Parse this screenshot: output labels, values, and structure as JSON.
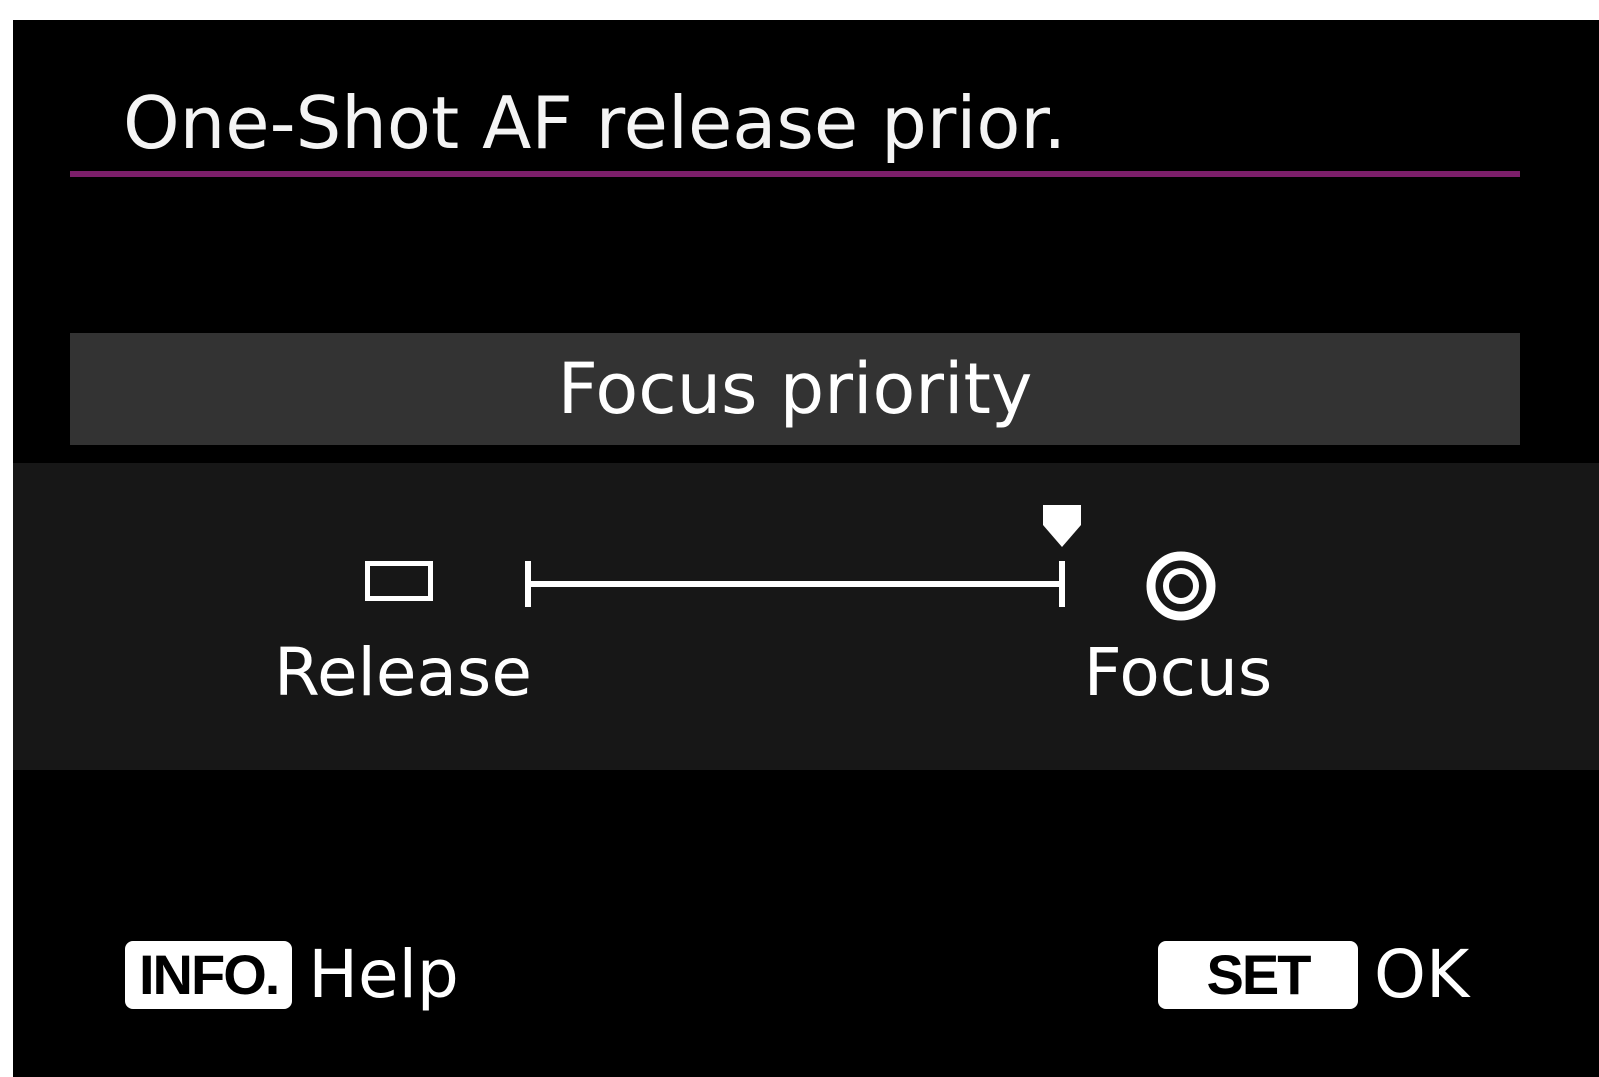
{
  "screen": {
    "title": "One-Shot AF release prior.",
    "accent_color": "#7c1f6a",
    "selected_value": "Focus priority",
    "slider": {
      "left_icon": "release-rectangle-icon",
      "left_label": "Release",
      "right_icon": "focus-ring-icon",
      "right_label": "Focus",
      "level": 1.0
    },
    "footer": {
      "info_key": "INFO.",
      "info_text": "Help",
      "set_key": "SET",
      "set_text": "OK"
    }
  }
}
